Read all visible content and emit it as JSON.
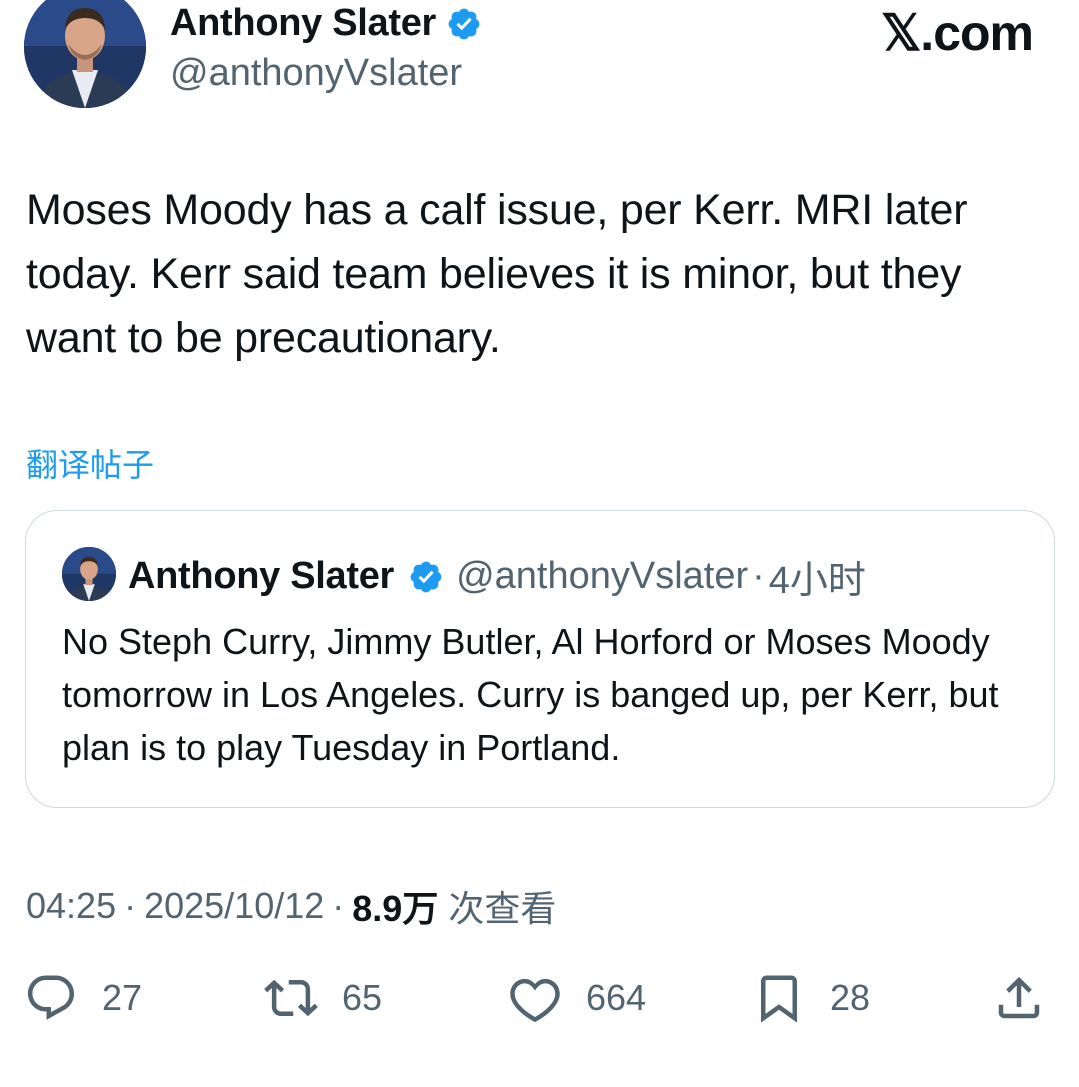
{
  "author": {
    "name": "Anthony Slater",
    "handle": "@anthonyVslater"
  },
  "brand": "𝕏.com",
  "tweet": {
    "text": "Moses Moody has a calf issue, per Kerr. MRI later today. Kerr said team believes it is minor, but they want to be precautionary.",
    "translate_label": "翻译帖子"
  },
  "quote": {
    "name": "Anthony Slater",
    "handle": "@anthonyVslater",
    "separator": "·",
    "time": "4小时",
    "text": "No Steph Curry, Jimmy Butler, Al Horford or Moses Moody tomorrow in Los Angeles. Curry is banged up, per Kerr, but plan is to play Tuesday in Portland."
  },
  "meta": {
    "time": "04:25",
    "separator": "·",
    "date": "2025/10/12",
    "views": "8.9万",
    "views_label": "次查看"
  },
  "actions": {
    "replies": "27",
    "reposts": "65",
    "likes": "664",
    "bookmarks": "28"
  },
  "colors": {
    "accent": "#1d9bf0",
    "text": "#0f1419",
    "secondary": "#536471",
    "border": "#cfd9de"
  },
  "icons": [
    "verified-badge-icon",
    "reply-icon",
    "repost-icon",
    "like-icon",
    "bookmark-icon",
    "share-icon"
  ]
}
